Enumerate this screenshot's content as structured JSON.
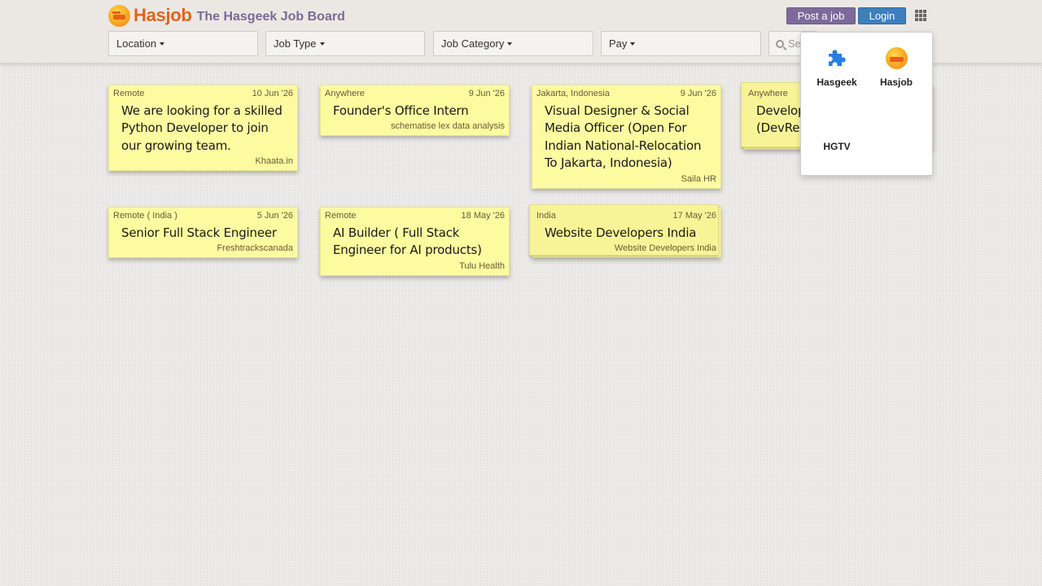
{
  "header": {
    "brand_name": "Hasjob",
    "brand_tagline": "The Hasgeek Job Board",
    "post_job_label": "Post a job",
    "login_label": "Login"
  },
  "filters": {
    "location": "Location",
    "job_type": "Job Type",
    "job_category": "Job Category",
    "pay": "Pay",
    "search_placeholder": "Search"
  },
  "apps_menu": {
    "items": [
      {
        "label": "Hasgeek",
        "icon": "puzzle-icon"
      },
      {
        "label": "Hasjob",
        "icon": "hasjob-logo-icon"
      },
      {
        "label": "HGTV",
        "icon": ""
      }
    ]
  },
  "jobs": [
    {
      "location": "Remote",
      "date": "10 Jun '26",
      "title": "We are looking for a skilled Python Developer to join our growing team.",
      "company": "Khaata.in"
    },
    {
      "location": "Anywhere",
      "date": "9 Jun '26",
      "title": "Founder's Office Intern",
      "company": "schematise lex data analysis"
    },
    {
      "location": "Jakarta, Indonesia",
      "date": "9 Jun '26",
      "title": "Visual Designer & Social Media Officer (Open For Indian National-Relocation To Jakarta, Indonesia)",
      "company": "Saila HR"
    },
    {
      "location": "Anywhere",
      "date": "",
      "title": "Develop (DevRel",
      "company": ""
    },
    {
      "location": "Remote ( India )",
      "date": "5 Jun '26",
      "title": "Senior Full Stack Engineer",
      "company": "Freshtrackscanada"
    },
    {
      "location": "Remote",
      "date": "18 May '26",
      "title": "AI Builder ( Full Stack Engineer for AI products)",
      "company": "Tulu Health"
    },
    {
      "location": "India",
      "date": "17 May '26",
      "title": "Website Developers India",
      "company": "Website Developers India"
    }
  ],
  "colors": {
    "brand_orange": "#e2631a",
    "tagline_purple": "#7b6a95",
    "post_button": "#7d6a9a",
    "login_button": "#3d7ebd",
    "card_yellow": "#fdfba0"
  }
}
